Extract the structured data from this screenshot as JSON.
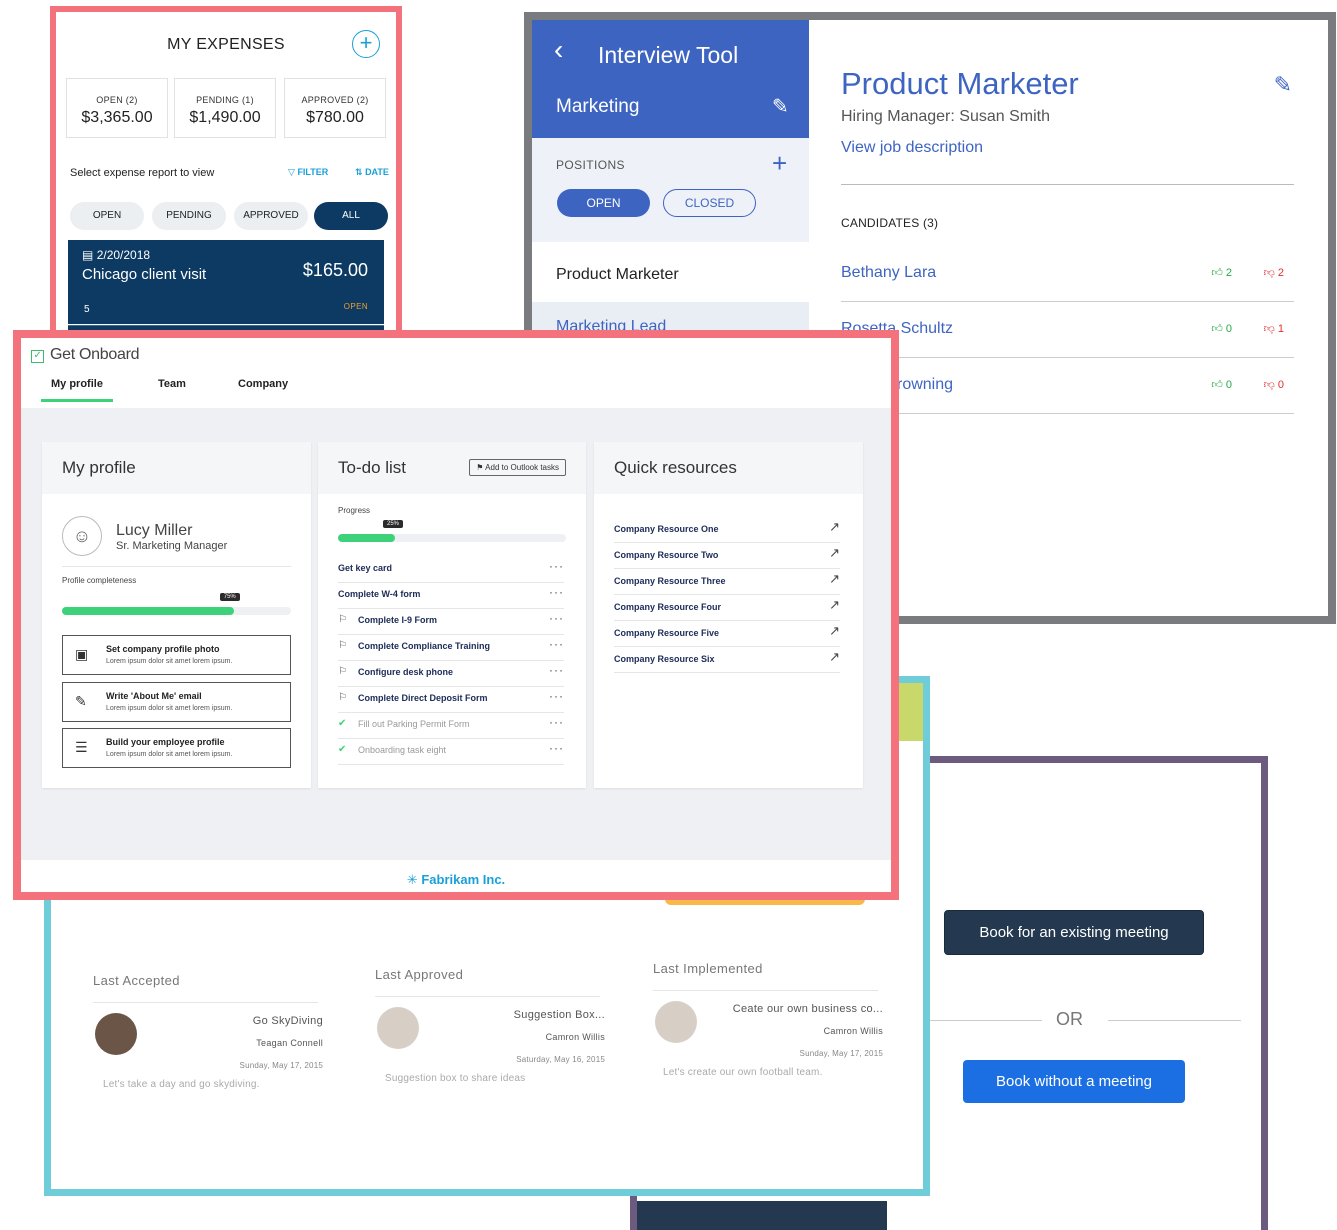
{
  "expenses": {
    "title": "MY EXPENSES",
    "add_icon": "+",
    "summary": [
      {
        "label": "OPEN (2)",
        "value": "$3,365.00"
      },
      {
        "label": "PENDING (1)",
        "value": "$1,490.00"
      },
      {
        "label": "APPROVED (2)",
        "value": "$780.00"
      }
    ],
    "select_text": "Select expense report to view",
    "filter_label": "FILTER",
    "date_label": "DATE",
    "tabs": [
      "OPEN",
      "PENDING",
      "APPROVED",
      "ALL"
    ],
    "active_tab": "ALL",
    "report": {
      "date": "2/20/2018",
      "name": "Chicago client visit",
      "amount": "$165.00",
      "count": "5",
      "status": "OPEN"
    },
    "accent_color": "#0c3a63"
  },
  "interview": {
    "app_title": "Interview Tool",
    "department": "Marketing",
    "positions_label": "POSITIONS",
    "open_tab": "OPEN",
    "closed_tab": "CLOSED",
    "jobs": [
      "Product Marketer",
      "Marketing Lead"
    ],
    "job_title": "Product Marketer",
    "hiring_manager": "Hiring Manager: Susan Smith",
    "view_description": "View job description",
    "candidates_label": "CANDIDATES (3)",
    "candidates": [
      {
        "name": "Bethany Lara",
        "up": "2",
        "down": "2"
      },
      {
        "name": "Rosetta Schultz",
        "up": "0",
        "down": "1"
      },
      {
        "name": "rowning",
        "up": "0",
        "down": "0"
      }
    ],
    "accent_color": "#3e64c2"
  },
  "onboard": {
    "app_name": "Get Onboard",
    "tabs": [
      "My profile",
      "Team",
      "Company"
    ],
    "active_tab": "My profile",
    "profile": {
      "panel_title": "My profile",
      "name": "Lucy Miller",
      "role": "Sr. Marketing Manager",
      "completeness_label": "Profile completeness",
      "completeness": 0.75,
      "completeness_text": "75%",
      "actions": [
        {
          "icon": "camera-icon",
          "title": "Set company profile photo",
          "sub": "Lorem ipsum dolor sit amet lorem ipsum."
        },
        {
          "icon": "edit-icon",
          "title": "Write 'About Me' email",
          "sub": "Lorem ipsum dolor sit amet lorem ipsum."
        },
        {
          "icon": "profile-list-icon",
          "title": "Build your employee profile",
          "sub": "Lorem ipsum dolor sit amet lorem ipsum."
        }
      ]
    },
    "todo": {
      "panel_title": "To-do list",
      "outlook_button": "Add to Outlook tasks",
      "progress_label": "Progress",
      "progress": 0.25,
      "progress_text": "25%",
      "items": [
        {
          "text": "Get key card",
          "icon": "none",
          "done": false
        },
        {
          "text": "Complete W-4 form",
          "icon": "none",
          "done": false
        },
        {
          "text": "Complete I-9 Form",
          "icon": "flag-icon",
          "done": false
        },
        {
          "text": "Complete Compliance Training",
          "icon": "flag-icon",
          "done": false
        },
        {
          "text": "Configure desk phone",
          "icon": "flag-icon",
          "done": false
        },
        {
          "text": "Complete Direct Deposit Form",
          "icon": "flag-icon",
          "done": false
        },
        {
          "text": "Fill out Parking Permit Form",
          "icon": "check-circle-icon",
          "done": true
        },
        {
          "text": "Onboarding task eight",
          "icon": "check-circle-icon",
          "done": true
        }
      ]
    },
    "resources": {
      "panel_title": "Quick resources",
      "items": [
        "Company Resource One",
        "Company Resource Two",
        "Company Resource Three",
        "Company Resource Four",
        "Company Resource Five",
        "Company Resource Six"
      ]
    },
    "footer": "Fabrikam Inc.",
    "accent_color": "#3dd27a"
  },
  "suggest": {
    "columns": [
      {
        "heading": "Last Accepted",
        "title": "Go SkyDiving",
        "author": "Teagan Connell",
        "date": "Sunday, May 17, 2015",
        "desc": "Let's take a day and go skydiving."
      },
      {
        "heading": "Last Approved",
        "title": "Suggestion Box...",
        "author": "Camron Willis",
        "date": "Saturday, May 16, 2015",
        "desc": "Suggestion box to share ideas"
      },
      {
        "heading": "Last Implemented",
        "title": "Ceate our own business co...",
        "author": "Camron Willis",
        "date": "Sunday, May 17, 2015",
        "desc": "Let's create our own football team."
      }
    ]
  },
  "booking": {
    "existing_button": "Book for an existing meeting",
    "or_text": "OR",
    "without_button": "Book without a meeting"
  }
}
